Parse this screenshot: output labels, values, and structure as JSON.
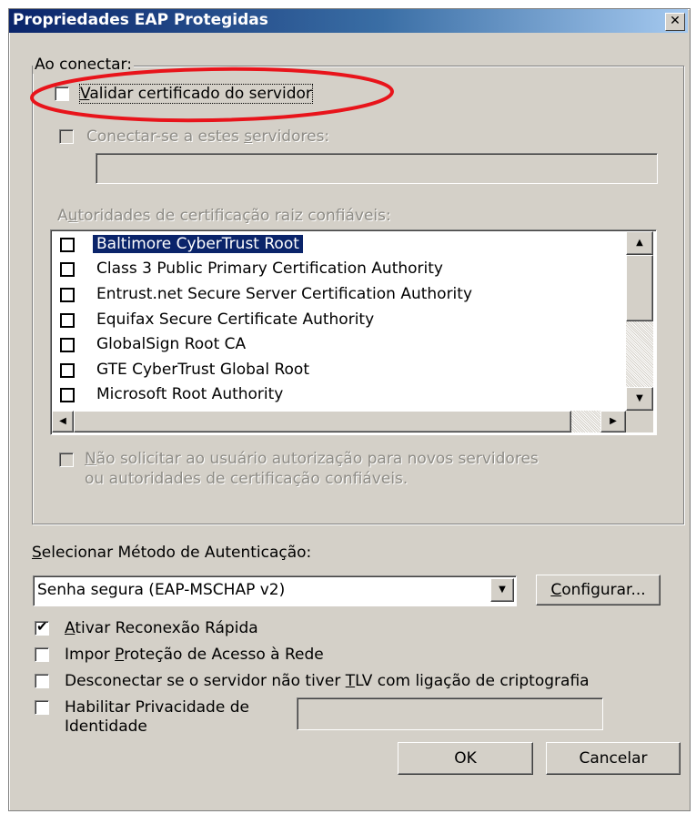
{
  "window": {
    "title": "Propriedades EAP Protegidas",
    "close_glyph": "✕"
  },
  "on_connect": {
    "group_label": "Ao conectar:",
    "validate_cert": {
      "label_pre": "",
      "label_key": "V",
      "label_rest": "alidar certificado do servidor",
      "checked": false
    },
    "connect_servers": {
      "label_pre": "Conectar-se a estes ",
      "label_key": "s",
      "label_rest": "ervidores:",
      "checked": false,
      "value": ""
    },
    "root_ca_label_pre": "A",
    "root_ca_label_key": "u",
    "root_ca_label_rest": "toridades de certificação raiz confiáveis:",
    "root_cas": [
      {
        "label": "Baltimore CyberTrust Root",
        "checked": false,
        "selected": true
      },
      {
        "label": "Class 3 Public Primary Certification Authority",
        "checked": false,
        "selected": false
      },
      {
        "label": "Entrust.net Secure Server Certification Authority",
        "checked": false,
        "selected": false
      },
      {
        "label": "Equifax Secure Certificate Authority",
        "checked": false,
        "selected": false
      },
      {
        "label": "GlobalSign Root CA",
        "checked": false,
        "selected": false
      },
      {
        "label": "GTE CyberTrust Global Root",
        "checked": false,
        "selected": false
      },
      {
        "label": "Microsoft Root Authority",
        "checked": false,
        "selected": false
      }
    ],
    "no_prompt": {
      "line1_key": "N",
      "line1_rest": "ão solicitar ao usuário autorização para novos servidores",
      "line2": "ou autoridades de certificação confiáveis.",
      "checked": false
    }
  },
  "auth": {
    "label_pre": "",
    "label_key": "S",
    "label_rest": "elecionar Método de Autenticação:",
    "method": "Senha segura (EAP-MSCHAP v2)",
    "configure_key": "C",
    "configure_rest": "onfigurar..."
  },
  "options": {
    "fast_reconnect": {
      "label_key": "A",
      "label_rest": "tivar Reconexão Rápida",
      "checked": true
    },
    "nap": {
      "label_pre": "Impor ",
      "label_key": "P",
      "label_rest": "roteção de Acesso à Rede",
      "checked": false
    },
    "disconnect_tlv": {
      "label_pre": "Desconectar se o servidor não tiver ",
      "label_key": "T",
      "label_rest": "LV com ligação de criptografia",
      "checked": false
    },
    "identity_privacy": {
      "label_line1": "Habilitar Privacidade de",
      "label_line2": "Identidade",
      "checked": false,
      "value": ""
    }
  },
  "buttons": {
    "ok": "OK",
    "cancel": "Cancelar"
  },
  "annotation": {
    "color": "#e8141b"
  }
}
